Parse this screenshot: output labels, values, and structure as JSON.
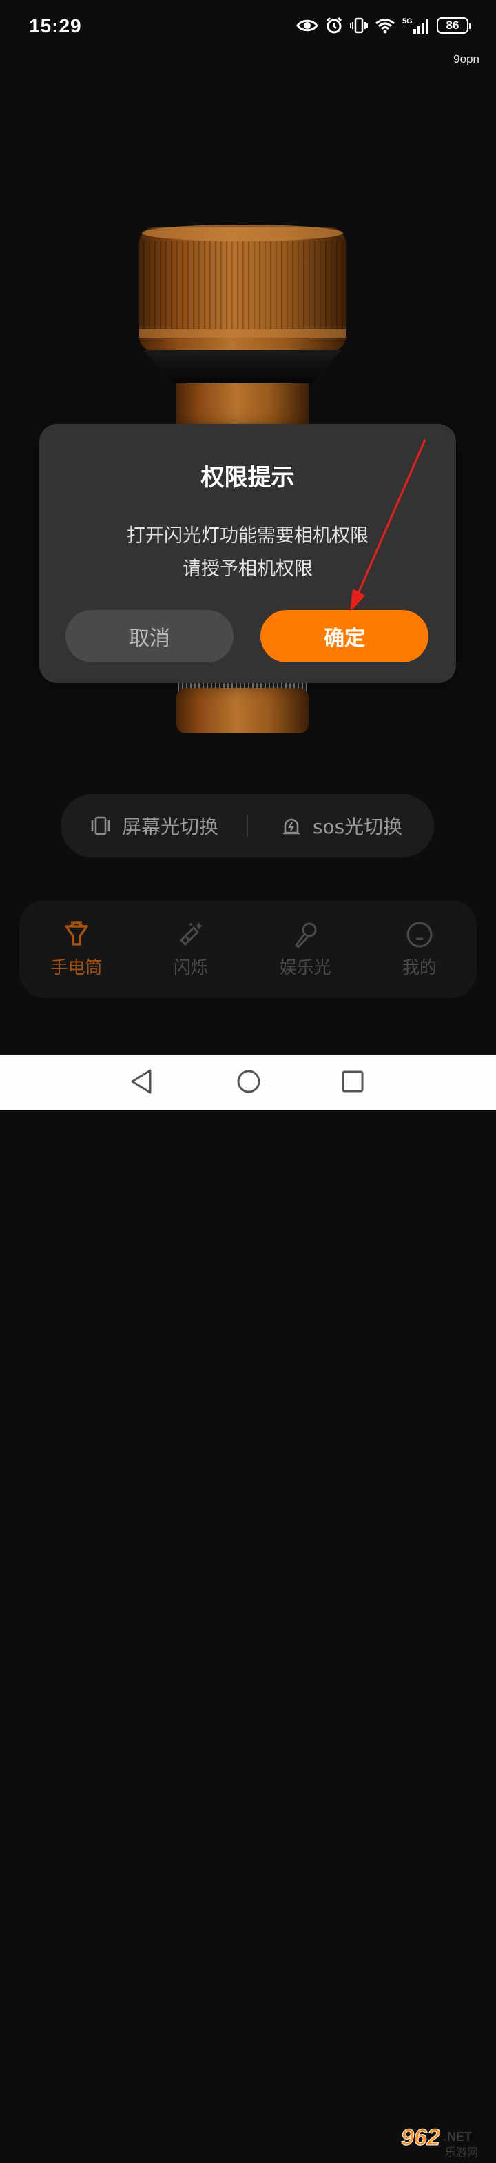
{
  "status_bar": {
    "time": "15:29",
    "battery": "86",
    "network": "5G",
    "net_speed": "9opn"
  },
  "dialog": {
    "title": "权限提示",
    "message_line1": "打开闪光灯功能需要相机权限",
    "message_line2": "请授予相机权限",
    "cancel_label": "取消",
    "confirm_label": "确定"
  },
  "mode_switch": {
    "screen_light": "屏幕光切换",
    "sos_light": "sos光切换"
  },
  "bottom_nav": {
    "items": [
      {
        "label": "手电筒",
        "icon": "flashlight-icon",
        "active": true
      },
      {
        "label": "闪烁",
        "icon": "magic-wand-icon",
        "active": false
      },
      {
        "label": "娱乐光",
        "icon": "microphone-icon",
        "active": false
      },
      {
        "label": "我的",
        "icon": "profile-icon",
        "active": false
      }
    ]
  },
  "watermark": {
    "text_main": "962",
    "text_suffix": ".NET",
    "text_cn": "乐游网"
  },
  "colors": {
    "accent": "#ff7b00",
    "active_nav": "#a5520c",
    "dialog_bg": "#333333",
    "page_bg": "#0d0d0d"
  }
}
